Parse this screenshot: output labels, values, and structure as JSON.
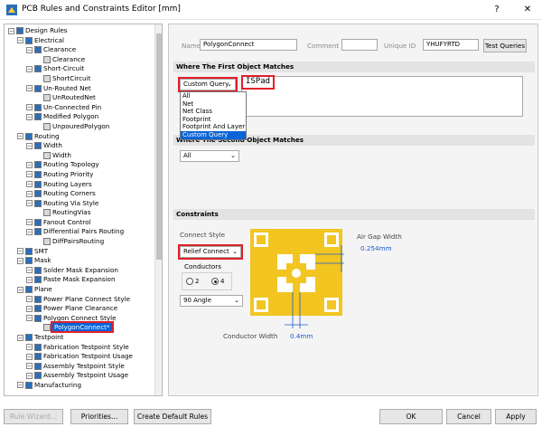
{
  "window": {
    "title": "PCB Rules and Constraints Editor [mm]",
    "help_label": "?",
    "close_label": "✕"
  },
  "tree": {
    "root": "Design Rules",
    "nodes": [
      {
        "label": "Electrical"
      },
      {
        "label": "Clearance"
      },
      {
        "label": "Clearance"
      },
      {
        "label": "Short-Circuit"
      },
      {
        "label": "ShortCircuit"
      },
      {
        "label": "Un-Routed Net"
      },
      {
        "label": "UnRoutedNet"
      },
      {
        "label": "Un-Connected Pin"
      },
      {
        "label": "Modified Polygon"
      },
      {
        "label": "UnpouredPolygon"
      },
      {
        "label": "Routing"
      },
      {
        "label": "Width"
      },
      {
        "label": "Width"
      },
      {
        "label": "Routing Topology"
      },
      {
        "label": "Routing Priority"
      },
      {
        "label": "Routing Layers"
      },
      {
        "label": "Routing Corners"
      },
      {
        "label": "Routing Via Style"
      },
      {
        "label": "RoutingVias"
      },
      {
        "label": "Fanout Control"
      },
      {
        "label": "Differential Pairs Routing"
      },
      {
        "label": "DiffPairsRouting"
      },
      {
        "label": "SMT"
      },
      {
        "label": "Mask"
      },
      {
        "label": "Solder Mask Expansion"
      },
      {
        "label": "Paste Mask Expansion"
      },
      {
        "label": "Plane"
      },
      {
        "label": "Power Plane Connect Style"
      },
      {
        "label": "Power Plane Clearance"
      },
      {
        "label": "Polygon Connect Style"
      },
      {
        "label": "PolygonConnect*"
      },
      {
        "label": "Testpoint"
      },
      {
        "label": "Fabrication Testpoint Style"
      },
      {
        "label": "Fabrication Testpoint Usage"
      },
      {
        "label": "Assembly Testpoint Style"
      },
      {
        "label": "Assembly Testpoint Usage"
      },
      {
        "label": "Manufacturing"
      }
    ]
  },
  "rule": {
    "name_label": "Name",
    "name_value": "PolygonConnect",
    "comment_label": "Comment",
    "comment_value": "",
    "uid_label": "Unique ID",
    "uid_value": "YHUFYRTD",
    "test_queries_label": "Test Queries"
  },
  "first_match": {
    "header": "Where The First Object Matches",
    "selected": "Custom Query",
    "query_text": "ISPad",
    "options": [
      "All",
      "Net",
      "Net Class",
      "Footprint",
      "Footprint And Layer",
      "Custom Query"
    ]
  },
  "second_match": {
    "header": "Where The Second Object Matches",
    "selected": "All"
  },
  "constraints": {
    "header": "Constraints",
    "connect_style_label": "Connect Style",
    "connect_style_value": "Relief Connect",
    "conductors_label": "Conductors",
    "conductor_options": [
      "2",
      "4"
    ],
    "conductors_selected": "4",
    "angle_value": "90 Angle",
    "air_gap_label": "Air Gap Width",
    "air_gap_value": "0.254mm",
    "conductor_width_label": "Conductor Width",
    "conductor_width_value": "0.4mm",
    "pad_color": "#f2c521"
  },
  "footer": {
    "rule_wizard": "Rule Wizard...",
    "priorities": "Priorities...",
    "create_default": "Create Default Rules",
    "ok": "OK",
    "cancel": "Cancel",
    "apply": "Apply"
  }
}
